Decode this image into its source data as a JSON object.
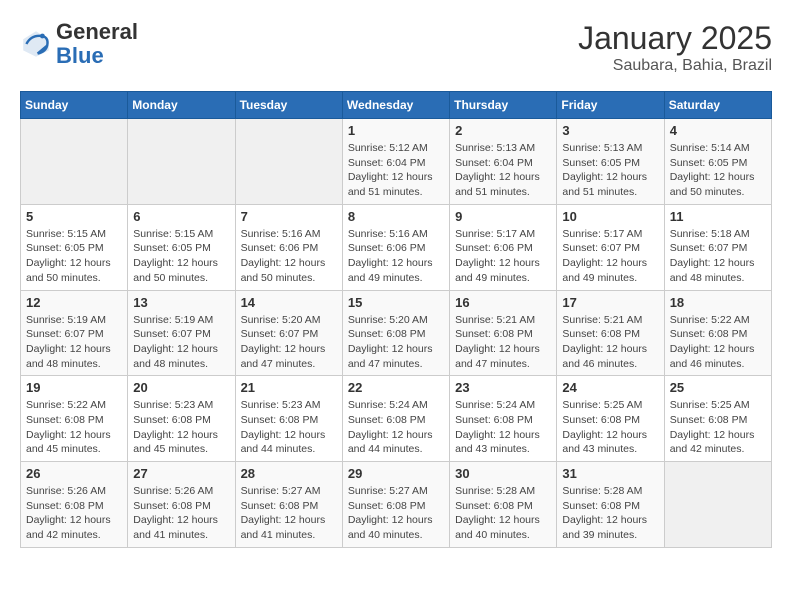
{
  "header": {
    "logo_line1": "General",
    "logo_line2": "Blue",
    "month": "January 2025",
    "location": "Saubara, Bahia, Brazil"
  },
  "days_of_week": [
    "Sunday",
    "Monday",
    "Tuesday",
    "Wednesday",
    "Thursday",
    "Friday",
    "Saturday"
  ],
  "weeks": [
    [
      {
        "num": "",
        "info": ""
      },
      {
        "num": "",
        "info": ""
      },
      {
        "num": "",
        "info": ""
      },
      {
        "num": "1",
        "info": "Sunrise: 5:12 AM\nSunset: 6:04 PM\nDaylight: 12 hours\nand 51 minutes."
      },
      {
        "num": "2",
        "info": "Sunrise: 5:13 AM\nSunset: 6:04 PM\nDaylight: 12 hours\nand 51 minutes."
      },
      {
        "num": "3",
        "info": "Sunrise: 5:13 AM\nSunset: 6:05 PM\nDaylight: 12 hours\nand 51 minutes."
      },
      {
        "num": "4",
        "info": "Sunrise: 5:14 AM\nSunset: 6:05 PM\nDaylight: 12 hours\nand 50 minutes."
      }
    ],
    [
      {
        "num": "5",
        "info": "Sunrise: 5:15 AM\nSunset: 6:05 PM\nDaylight: 12 hours\nand 50 minutes."
      },
      {
        "num": "6",
        "info": "Sunrise: 5:15 AM\nSunset: 6:05 PM\nDaylight: 12 hours\nand 50 minutes."
      },
      {
        "num": "7",
        "info": "Sunrise: 5:16 AM\nSunset: 6:06 PM\nDaylight: 12 hours\nand 50 minutes."
      },
      {
        "num": "8",
        "info": "Sunrise: 5:16 AM\nSunset: 6:06 PM\nDaylight: 12 hours\nand 49 minutes."
      },
      {
        "num": "9",
        "info": "Sunrise: 5:17 AM\nSunset: 6:06 PM\nDaylight: 12 hours\nand 49 minutes."
      },
      {
        "num": "10",
        "info": "Sunrise: 5:17 AM\nSunset: 6:07 PM\nDaylight: 12 hours\nand 49 minutes."
      },
      {
        "num": "11",
        "info": "Sunrise: 5:18 AM\nSunset: 6:07 PM\nDaylight: 12 hours\nand 48 minutes."
      }
    ],
    [
      {
        "num": "12",
        "info": "Sunrise: 5:19 AM\nSunset: 6:07 PM\nDaylight: 12 hours\nand 48 minutes."
      },
      {
        "num": "13",
        "info": "Sunrise: 5:19 AM\nSunset: 6:07 PM\nDaylight: 12 hours\nand 48 minutes."
      },
      {
        "num": "14",
        "info": "Sunrise: 5:20 AM\nSunset: 6:07 PM\nDaylight: 12 hours\nand 47 minutes."
      },
      {
        "num": "15",
        "info": "Sunrise: 5:20 AM\nSunset: 6:08 PM\nDaylight: 12 hours\nand 47 minutes."
      },
      {
        "num": "16",
        "info": "Sunrise: 5:21 AM\nSunset: 6:08 PM\nDaylight: 12 hours\nand 47 minutes."
      },
      {
        "num": "17",
        "info": "Sunrise: 5:21 AM\nSunset: 6:08 PM\nDaylight: 12 hours\nand 46 minutes."
      },
      {
        "num": "18",
        "info": "Sunrise: 5:22 AM\nSunset: 6:08 PM\nDaylight: 12 hours\nand 46 minutes."
      }
    ],
    [
      {
        "num": "19",
        "info": "Sunrise: 5:22 AM\nSunset: 6:08 PM\nDaylight: 12 hours\nand 45 minutes."
      },
      {
        "num": "20",
        "info": "Sunrise: 5:23 AM\nSunset: 6:08 PM\nDaylight: 12 hours\nand 45 minutes."
      },
      {
        "num": "21",
        "info": "Sunrise: 5:23 AM\nSunset: 6:08 PM\nDaylight: 12 hours\nand 44 minutes."
      },
      {
        "num": "22",
        "info": "Sunrise: 5:24 AM\nSunset: 6:08 PM\nDaylight: 12 hours\nand 44 minutes."
      },
      {
        "num": "23",
        "info": "Sunrise: 5:24 AM\nSunset: 6:08 PM\nDaylight: 12 hours\nand 43 minutes."
      },
      {
        "num": "24",
        "info": "Sunrise: 5:25 AM\nSunset: 6:08 PM\nDaylight: 12 hours\nand 43 minutes."
      },
      {
        "num": "25",
        "info": "Sunrise: 5:25 AM\nSunset: 6:08 PM\nDaylight: 12 hours\nand 42 minutes."
      }
    ],
    [
      {
        "num": "26",
        "info": "Sunrise: 5:26 AM\nSunset: 6:08 PM\nDaylight: 12 hours\nand 42 minutes."
      },
      {
        "num": "27",
        "info": "Sunrise: 5:26 AM\nSunset: 6:08 PM\nDaylight: 12 hours\nand 41 minutes."
      },
      {
        "num": "28",
        "info": "Sunrise: 5:27 AM\nSunset: 6:08 PM\nDaylight: 12 hours\nand 41 minutes."
      },
      {
        "num": "29",
        "info": "Sunrise: 5:27 AM\nSunset: 6:08 PM\nDaylight: 12 hours\nand 40 minutes."
      },
      {
        "num": "30",
        "info": "Sunrise: 5:28 AM\nSunset: 6:08 PM\nDaylight: 12 hours\nand 40 minutes."
      },
      {
        "num": "31",
        "info": "Sunrise: 5:28 AM\nSunset: 6:08 PM\nDaylight: 12 hours\nand 39 minutes."
      },
      {
        "num": "",
        "info": ""
      }
    ]
  ]
}
